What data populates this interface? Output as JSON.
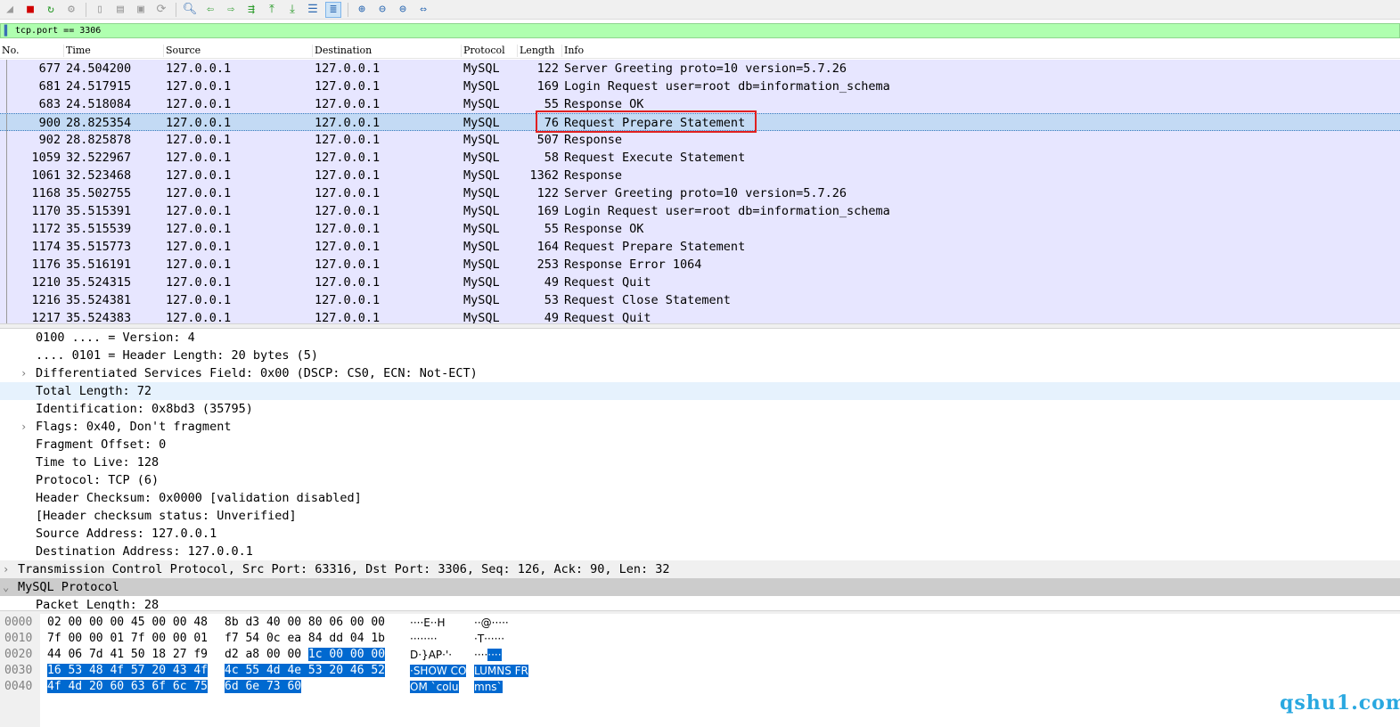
{
  "toolbar": {
    "buttons": [
      {
        "name": "shark-fin-start-icon",
        "glyph": "◢",
        "tone": "gray"
      },
      {
        "name": "stop-capture-icon",
        "glyph": "■",
        "tone": "red"
      },
      {
        "name": "restart-capture-icon",
        "glyph": "↻",
        "tone": "green"
      },
      {
        "name": "capture-options-icon",
        "glyph": "⚙",
        "tone": "gray"
      },
      {
        "sep": true
      },
      {
        "name": "open-file-icon",
        "glyph": "▯",
        "tone": "gray"
      },
      {
        "name": "save-file-icon",
        "glyph": "▤",
        "tone": "gray"
      },
      {
        "name": "close-file-icon",
        "glyph": "▣",
        "tone": "gray"
      },
      {
        "name": "reload-file-icon",
        "glyph": "⟳",
        "tone": "gray"
      },
      {
        "sep": true
      },
      {
        "name": "find-packet-icon",
        "glyph": "🔍︎",
        "tone": "blue"
      },
      {
        "name": "go-back-icon",
        "glyph": "⇦",
        "tone": "green"
      },
      {
        "name": "go-forward-icon",
        "glyph": "⇨",
        "tone": "green"
      },
      {
        "name": "go-to-packet-icon",
        "glyph": "⇶",
        "tone": "green"
      },
      {
        "name": "first-packet-icon",
        "glyph": "⤒",
        "tone": "green"
      },
      {
        "name": "last-packet-icon",
        "glyph": "⤓",
        "tone": "green"
      },
      {
        "name": "auto-scroll-icon",
        "glyph": "☰",
        "tone": "blue"
      },
      {
        "name": "colorize-icon",
        "glyph": "≣",
        "tone": "blue",
        "selected": true
      },
      {
        "sep": true
      },
      {
        "name": "zoom-in-icon",
        "glyph": "⊕",
        "tone": "blue"
      },
      {
        "name": "zoom-out-icon",
        "glyph": "⊖",
        "tone": "blue"
      },
      {
        "name": "normal-size-icon",
        "glyph": "⊜",
        "tone": "blue"
      },
      {
        "name": "resize-columns-icon",
        "glyph": "⇔",
        "tone": "blue"
      }
    ]
  },
  "filter": {
    "value": "tcp.port == 3306",
    "bookmark_icon": "bookmark-icon"
  },
  "packet_list": {
    "columns": [
      "No.",
      "Time",
      "Source",
      "Destination",
      "Protocol",
      "Length",
      "Info"
    ],
    "rows": [
      {
        "no": "677",
        "time": "24.504200",
        "src": "127.0.0.1",
        "dst": "127.0.0.1",
        "proto": "MySQL",
        "len": "122",
        "info": "Server Greeting proto=10 version=5.7.26"
      },
      {
        "no": "681",
        "time": "24.517915",
        "src": "127.0.0.1",
        "dst": "127.0.0.1",
        "proto": "MySQL",
        "len": "169",
        "info": "Login Request user=root db=information_schema"
      },
      {
        "no": "683",
        "time": "24.518084",
        "src": "127.0.0.1",
        "dst": "127.0.0.1",
        "proto": "MySQL",
        "len": "55",
        "info": "Response OK"
      },
      {
        "no": "900",
        "time": "28.825354",
        "src": "127.0.0.1",
        "dst": "127.0.0.1",
        "proto": "MySQL",
        "len": "76",
        "info": "Request Prepare Statement",
        "selected": true
      },
      {
        "no": "902",
        "time": "28.825878",
        "src": "127.0.0.1",
        "dst": "127.0.0.1",
        "proto": "MySQL",
        "len": "507",
        "info": "Response"
      },
      {
        "no": "1059",
        "time": "32.522967",
        "src": "127.0.0.1",
        "dst": "127.0.0.1",
        "proto": "MySQL",
        "len": "58",
        "info": "Request Execute Statement"
      },
      {
        "no": "1061",
        "time": "32.523468",
        "src": "127.0.0.1",
        "dst": "127.0.0.1",
        "proto": "MySQL",
        "len": "1362",
        "info": "Response"
      },
      {
        "no": "1168",
        "time": "35.502755",
        "src": "127.0.0.1",
        "dst": "127.0.0.1",
        "proto": "MySQL",
        "len": "122",
        "info": "Server Greeting proto=10 version=5.7.26"
      },
      {
        "no": "1170",
        "time": "35.515391",
        "src": "127.0.0.1",
        "dst": "127.0.0.1",
        "proto": "MySQL",
        "len": "169",
        "info": "Login Request user=root db=information_schema"
      },
      {
        "no": "1172",
        "time": "35.515539",
        "src": "127.0.0.1",
        "dst": "127.0.0.1",
        "proto": "MySQL",
        "len": "55",
        "info": "Response OK"
      },
      {
        "no": "1174",
        "time": "35.515773",
        "src": "127.0.0.1",
        "dst": "127.0.0.1",
        "proto": "MySQL",
        "len": "164",
        "info": "Request Prepare Statement"
      },
      {
        "no": "1176",
        "time": "35.516191",
        "src": "127.0.0.1",
        "dst": "127.0.0.1",
        "proto": "MySQL",
        "len": "253",
        "info": "Response Error 1064"
      },
      {
        "no": "1210",
        "time": "35.524315",
        "src": "127.0.0.1",
        "dst": "127.0.0.1",
        "proto": "MySQL",
        "len": "49",
        "info": "Request Quit"
      },
      {
        "no": "1216",
        "time": "35.524381",
        "src": "127.0.0.1",
        "dst": "127.0.0.1",
        "proto": "MySQL",
        "len": "53",
        "info": "Request Close Statement"
      },
      {
        "no": "1217",
        "time": "35.524383",
        "src": "127.0.0.1",
        "dst": "127.0.0.1",
        "proto": "MySQL",
        "len": "49",
        "info": "Request Quit"
      }
    ]
  },
  "details": {
    "rows": [
      {
        "text": "0100 .... = Version: 4",
        "level": 2
      },
      {
        "text": ".... 0101 = Header Length: 20 bytes (5)",
        "level": 2
      },
      {
        "text": "Differentiated Services Field: 0x00 (DSCP: CS0, ECN: Not-ECT)",
        "level": 2,
        "expander": "›"
      },
      {
        "text": "Total Length: 72",
        "level": 2,
        "style": "hl"
      },
      {
        "text": "Identification: 0x8bd3 (35795)",
        "level": 2
      },
      {
        "text": "Flags: 0x40, Don't fragment",
        "level": 2,
        "expander": "›"
      },
      {
        "text": "Fragment Offset: 0",
        "level": 2
      },
      {
        "text": "Time to Live: 128",
        "level": 2
      },
      {
        "text": "Protocol: TCP (6)",
        "level": 2
      },
      {
        "text": "Header Checksum: 0x0000 [validation disabled]",
        "level": 2
      },
      {
        "text": "[Header checksum status: Unverified]",
        "level": 2
      },
      {
        "text": "Source Address: 127.0.0.1",
        "level": 2
      },
      {
        "text": "Destination Address: 127.0.0.1",
        "level": 2
      },
      {
        "text": "Transmission Control Protocol, Src Port: 63316, Dst Port: 3306, Seq: 126, Ack: 90, Len: 32",
        "level": 1,
        "expander": "›",
        "style": "hdr"
      },
      {
        "text": "MySQL Protocol",
        "level": 1,
        "expander": "⌄",
        "style": "sel"
      },
      {
        "text": "Packet Length: 28",
        "level": 2
      }
    ]
  },
  "bytes": {
    "lines": [
      {
        "offset": "0000",
        "hex1": [
          {
            "t": "02 00 00 00 45 00 00 48"
          }
        ],
        "hex2": [
          {
            "t": "8b d3 40 00 80 06 00 00"
          }
        ],
        "asc1": [
          {
            "t": "····E··H"
          }
        ],
        "asc2": [
          {
            "t": "··@·····"
          }
        ]
      },
      {
        "offset": "0010",
        "hex1": [
          {
            "t": "7f 00 00 01 7f 00 00 01"
          }
        ],
        "hex2": [
          {
            "t": "f7 54 0c ea 84 dd 04 1b"
          }
        ],
        "asc1": [
          {
            "t": "········"
          }
        ],
        "asc2": [
          {
            "t": "·T······"
          }
        ]
      },
      {
        "offset": "0020",
        "hex1": [
          {
            "t": "44 06 7d 41 50 18 27 f9"
          }
        ],
        "hex2": [
          {
            "t": "d2 a8 00 00 "
          },
          {
            "t": "1c 00 00 00",
            "h": true
          }
        ],
        "asc1": [
          {
            "t": "D·}AP·'·"
          }
        ],
        "asc2": [
          {
            "t": "····"
          },
          {
            "t": "····",
            "h": true
          }
        ]
      },
      {
        "offset": "0030",
        "hex1": [
          {
            "t": "16 53 48 4f 57 20 43 4f",
            "h": true
          }
        ],
        "hex2": [
          {
            "t": "4c 55 4d 4e 53 20 46 52",
            "h": true
          }
        ],
        "asc1": [
          {
            "t": "·SHOW CO",
            "h": true
          }
        ],
        "asc2": [
          {
            "t": "LUMNS FR",
            "h": true
          }
        ]
      },
      {
        "offset": "0040",
        "hex1": [
          {
            "t": "4f 4d 20 60 63 6f 6c 75",
            "h": true
          }
        ],
        "hex2": [
          {
            "t": "6d 6e 73 60",
            "h": true
          }
        ],
        "asc1": [
          {
            "t": "OM `colu",
            "h": true
          }
        ],
        "asc2": [
          {
            "t": "mns`",
            "h": true
          }
        ]
      }
    ]
  },
  "watermark": "qshu1.com"
}
